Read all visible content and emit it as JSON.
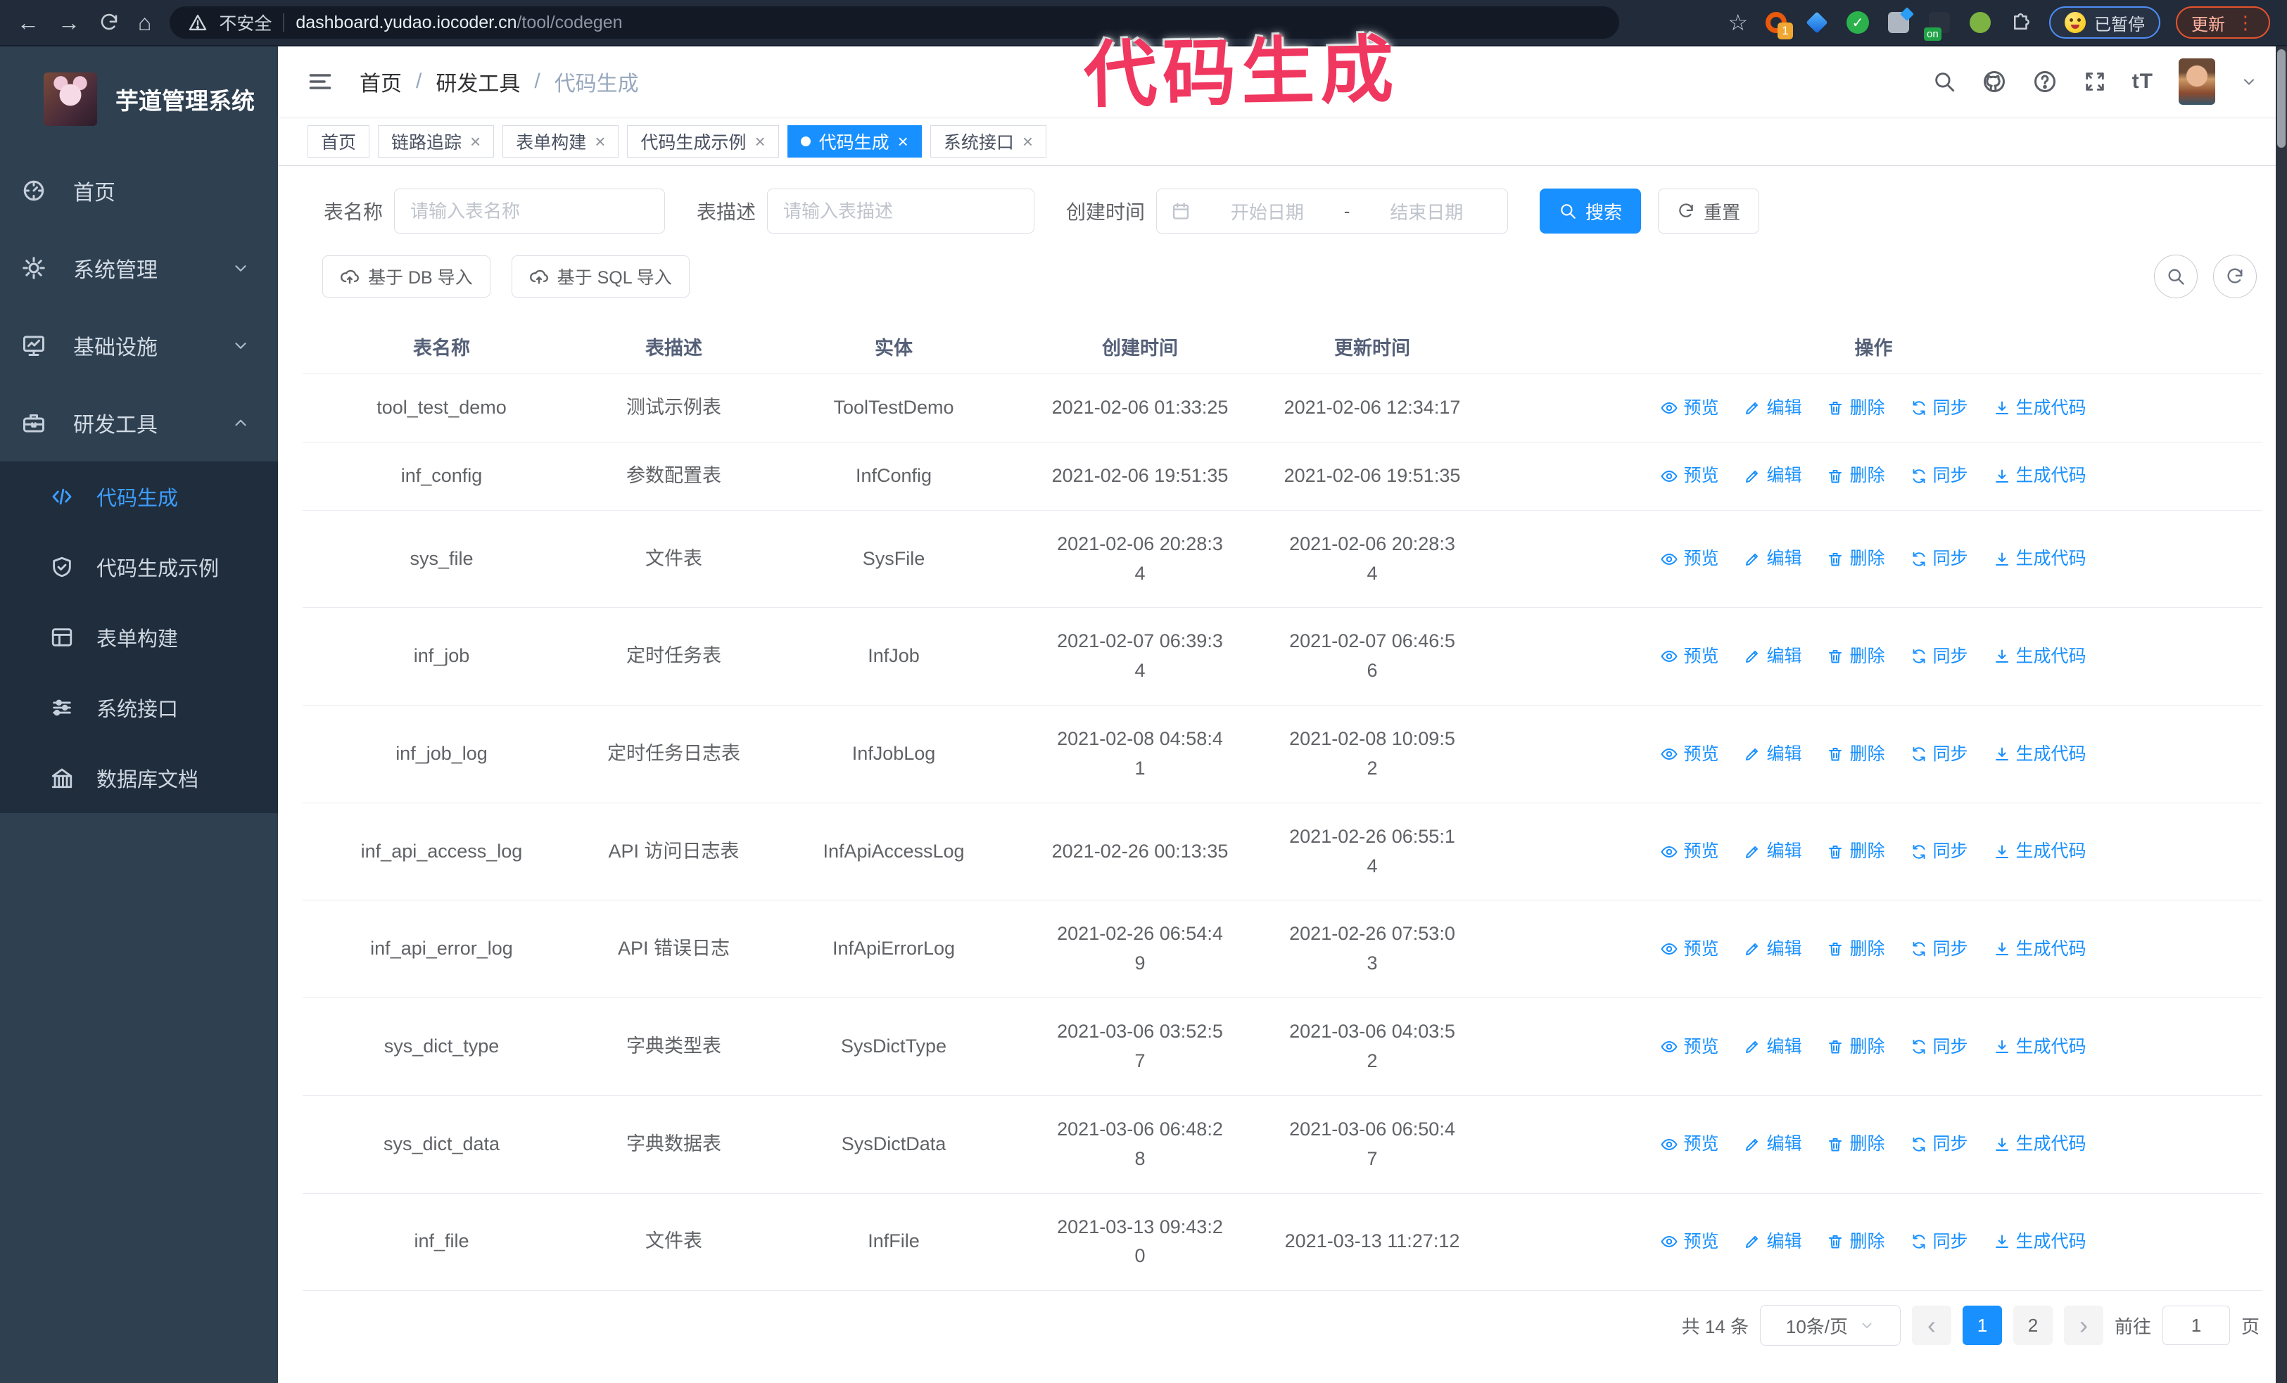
{
  "browser": {
    "security_label": "不安全",
    "url_host": "dashboard.yudao.iocoder.cn",
    "url_path": "/tool/codegen",
    "ext_badge_count": "1",
    "ext_on_label": "on",
    "paused_label": "已暂停",
    "update_label": "更新"
  },
  "icons": {
    "back": "←",
    "forward": "→",
    "home": "⌂",
    "star": "☆",
    "menu_dots": "⋮",
    "prev": "‹",
    "next": "›",
    "font_size": "tT"
  },
  "annotation": {
    "text": "代码生成",
    "color": "#f0375f"
  },
  "sidebar": {
    "title": "芋道管理系统",
    "items": [
      {
        "label": "首页"
      },
      {
        "label": "系统管理"
      },
      {
        "label": "基础设施"
      },
      {
        "label": "研发工具"
      }
    ],
    "submenu": [
      {
        "label": "代码生成",
        "active": true
      },
      {
        "label": "代码生成示例"
      },
      {
        "label": "表单构建"
      },
      {
        "label": "系统接口"
      },
      {
        "label": "数据库文档"
      }
    ]
  },
  "header": {
    "breadcrumb": [
      "首页",
      "研发工具",
      "代码生成"
    ],
    "separator": "/"
  },
  "tabs": [
    {
      "label": "首页",
      "closable": false,
      "active": false
    },
    {
      "label": "链路追踪",
      "closable": true,
      "active": false
    },
    {
      "label": "表单构建",
      "closable": true,
      "active": false
    },
    {
      "label": "代码生成示例",
      "closable": true,
      "active": false
    },
    {
      "label": "代码生成",
      "closable": true,
      "active": true
    },
    {
      "label": "系统接口",
      "closable": true,
      "active": false
    }
  ],
  "filters": {
    "table_name_label": "表名称",
    "table_name_placeholder": "请输入表名称",
    "table_desc_label": "表描述",
    "table_desc_placeholder": "请输入表描述",
    "create_time_label": "创建时间",
    "date_start_placeholder": "开始日期",
    "date_separator": "-",
    "date_end_placeholder": "结束日期",
    "search_label": "搜索",
    "reset_label": "重置"
  },
  "toolbar": {
    "import_db_label": "基于 DB 导入",
    "import_sql_label": "基于 SQL 导入"
  },
  "table": {
    "columns": [
      "表名称",
      "表描述",
      "实体",
      "创建时间",
      "更新时间",
      "操作"
    ],
    "actions": [
      "预览",
      "编辑",
      "删除",
      "同步",
      "生成代码"
    ],
    "rows": [
      {
        "name": "tool_test_demo",
        "desc": "测试示例表",
        "entity": "ToolTestDemo",
        "created": "2021-02-06 01:33:25",
        "updated": "2021-02-06 12:34:17"
      },
      {
        "name": "inf_config",
        "desc": "参数配置表",
        "entity": "InfConfig",
        "created": "2021-02-06 19:51:35",
        "updated": "2021-02-06 19:51:35"
      },
      {
        "name": "sys_file",
        "desc": "文件表",
        "entity": "SysFile",
        "created": "2021-02-06 20:28:3\n4",
        "updated": "2021-02-06 20:28:3\n4"
      },
      {
        "name": "inf_job",
        "desc": "定时任务表",
        "entity": "InfJob",
        "created": "2021-02-07 06:39:3\n4",
        "updated": "2021-02-07 06:46:5\n6"
      },
      {
        "name": "inf_job_log",
        "desc": "定时任务日志表",
        "entity": "InfJobLog",
        "created": "2021-02-08 04:58:4\n1",
        "updated": "2021-02-08 10:09:5\n2"
      },
      {
        "name": "inf_api_access_log",
        "desc": "API 访问日志表",
        "entity": "InfApiAccessLog",
        "created": "2021-02-26 00:13:35",
        "updated": "2021-02-26 06:55:1\n4"
      },
      {
        "name": "inf_api_error_log",
        "desc": "API 错误日志",
        "entity": "InfApiErrorLog",
        "created": "2021-02-26 06:54:4\n9",
        "updated": "2021-02-26 07:53:0\n3"
      },
      {
        "name": "sys_dict_type",
        "desc": "字典类型表",
        "entity": "SysDictType",
        "created": "2021-03-06 03:52:5\n7",
        "updated": "2021-03-06 04:03:5\n2"
      },
      {
        "name": "sys_dict_data",
        "desc": "字典数据表",
        "entity": "SysDictData",
        "created": "2021-03-06 06:48:2\n8",
        "updated": "2021-03-06 06:50:4\n7"
      },
      {
        "name": "inf_file",
        "desc": "文件表",
        "entity": "InfFile",
        "created": "2021-03-13 09:43:2\n0",
        "updated": "2021-03-13 11:27:12"
      }
    ]
  },
  "pagination": {
    "total_text": "共 14 条",
    "page_size": "10条/页",
    "pages": [
      "1",
      "2"
    ],
    "active_page": "1",
    "goto_label": "前往",
    "goto_value": "1",
    "page_unit": "页"
  },
  "colors": {
    "accent": "#1890ff",
    "sidebar_bg": "#2f4050",
    "submenu_bg": "#1f2d3d",
    "annotation": "#f0375f"
  }
}
